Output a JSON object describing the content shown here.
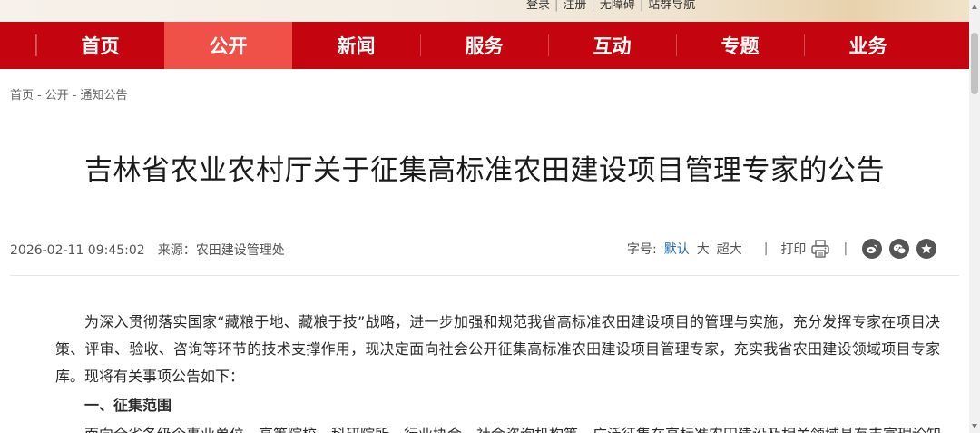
{
  "top_links": [
    "登录",
    "注册",
    "无障碍",
    "站群导航"
  ],
  "nav": [
    {
      "label": "首页",
      "active": false
    },
    {
      "label": "公开",
      "active": true
    },
    {
      "label": "新闻",
      "active": false
    },
    {
      "label": "服务",
      "active": false
    },
    {
      "label": "互动",
      "active": false
    },
    {
      "label": "专题",
      "active": false
    },
    {
      "label": "业务",
      "active": false
    }
  ],
  "breadcrumb": [
    "首页",
    "公开",
    "通知公告"
  ],
  "breadcrumb_sep": "-",
  "article": {
    "title": "吉林省农业农村厅关于征集高标准农田建设项目管理专家的公告",
    "datetime": "2026-02-11 09:45:02",
    "source": "来源：农田建设管理处",
    "font_size_label": "字号:",
    "font_sizes": [
      "默认",
      "大",
      "超大"
    ],
    "print_label": "打印",
    "divider": "|",
    "share_icons": [
      "weibo-icon",
      "wechat-icon",
      "favorite-icon"
    ],
    "paragraph1": "为深入贯彻落实国家“藏粮于地、藏粮于技”战略，进一步加强和规范我省高标准农田建设项目的管理与实施，充分发挥专家在项目决策、评审、验收、咨询等环节的技术支撑作用，现决定面向社会公开征集高标准农田建设项目管理专家，充实我省农田建设领域项目专家库。现将有关事项公告如下：",
    "heading1": "一、征集范围",
    "paragraph2": "面向全省各级企事业单位、高等院校、科研院所、行业协会、社会咨询机构等，广泛征集在高标准农田建设及相关领域具有丰富理论知"
  },
  "colors": {
    "nav_bg": "#c4050f",
    "nav_active": "#ef5148",
    "link_active": "#1a6db5"
  }
}
